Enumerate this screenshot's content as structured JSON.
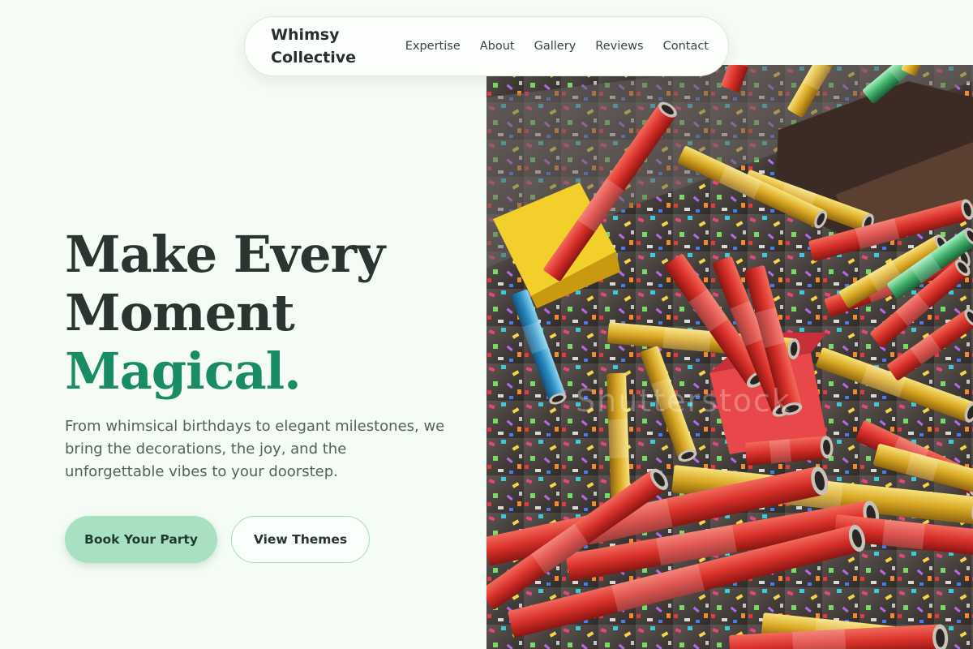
{
  "nav": {
    "brand": "Whimsy Collective",
    "links": [
      "Expertise",
      "About",
      "Gallery",
      "Reviews",
      "Contact"
    ]
  },
  "hero": {
    "line1": "Make Every",
    "line2": "Moment",
    "line3": "Magical.",
    "subtitle": "From whimsical birthdays to elegant milestones, we bring the decorations, the joy, and the unforgettable vibes to your doorstep.",
    "primary_cta": "Book Your Party",
    "secondary_cta": "View Themes"
  },
  "photo": {
    "watermark": "Shutterstock"
  },
  "colors": {
    "background": "#f5fcf5",
    "accent_green": "#1a8c65",
    "primary_button": "#a9e0c1"
  }
}
